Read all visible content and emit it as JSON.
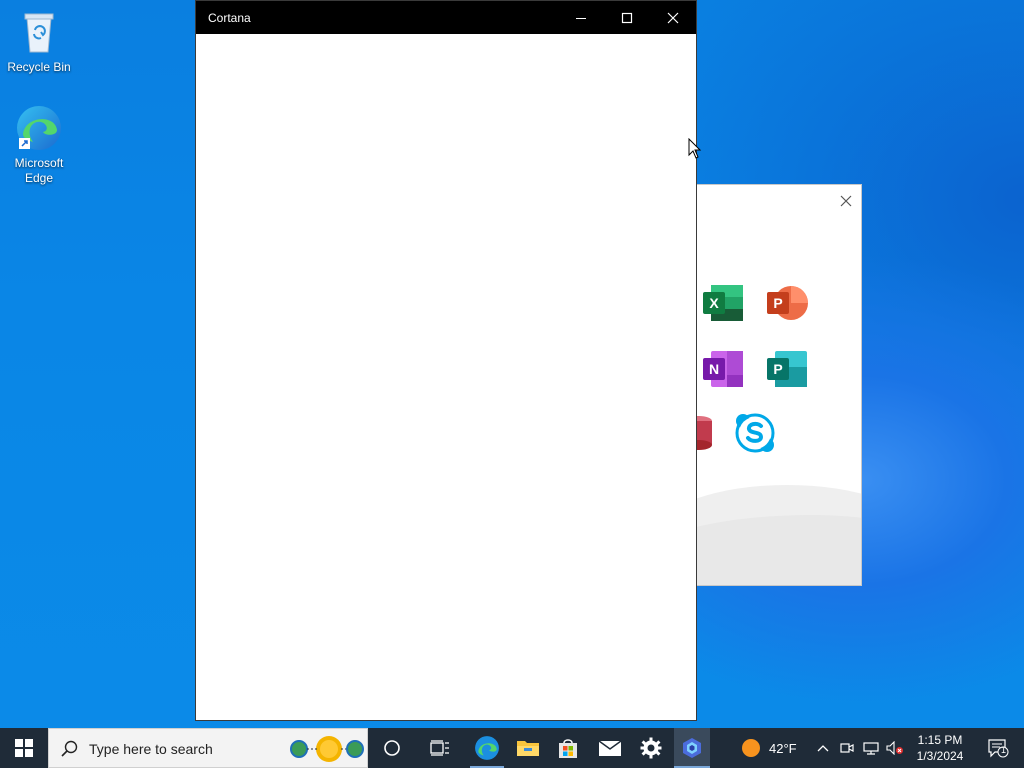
{
  "desktop": {
    "icons": [
      {
        "label": "Recycle Bin"
      },
      {
        "label": "Microsoft Edge"
      }
    ]
  },
  "cortana_window": {
    "title": "Cortana",
    "controls": {
      "minimize": "minimize",
      "maximize": "maximize",
      "close": "close"
    }
  },
  "office_panel": {
    "apps": [
      "Excel",
      "PowerPoint",
      "OneNote",
      "Publisher",
      "Access",
      "Skype"
    ],
    "tile_letters": {
      "excel": "X",
      "powerpoint": "P",
      "onenote": "N",
      "publisher": "P"
    }
  },
  "taskbar": {
    "search_placeholder": "Type here to search",
    "pinned": [
      "start-icon",
      "cortana-circle-icon",
      "task-view-icon",
      "edge-icon",
      "file-explorer-icon",
      "store-icon",
      "mail-icon",
      "settings-icon",
      "app-icon"
    ],
    "weather": {
      "temp": "42°F"
    },
    "clock": {
      "time": "1:15 PM",
      "date": "1/3/2024"
    },
    "notifications_count": "1"
  },
  "colors": {
    "taskbar": "#1f2b38",
    "desktop": "#0a86e6",
    "titlebar": "#000000"
  }
}
